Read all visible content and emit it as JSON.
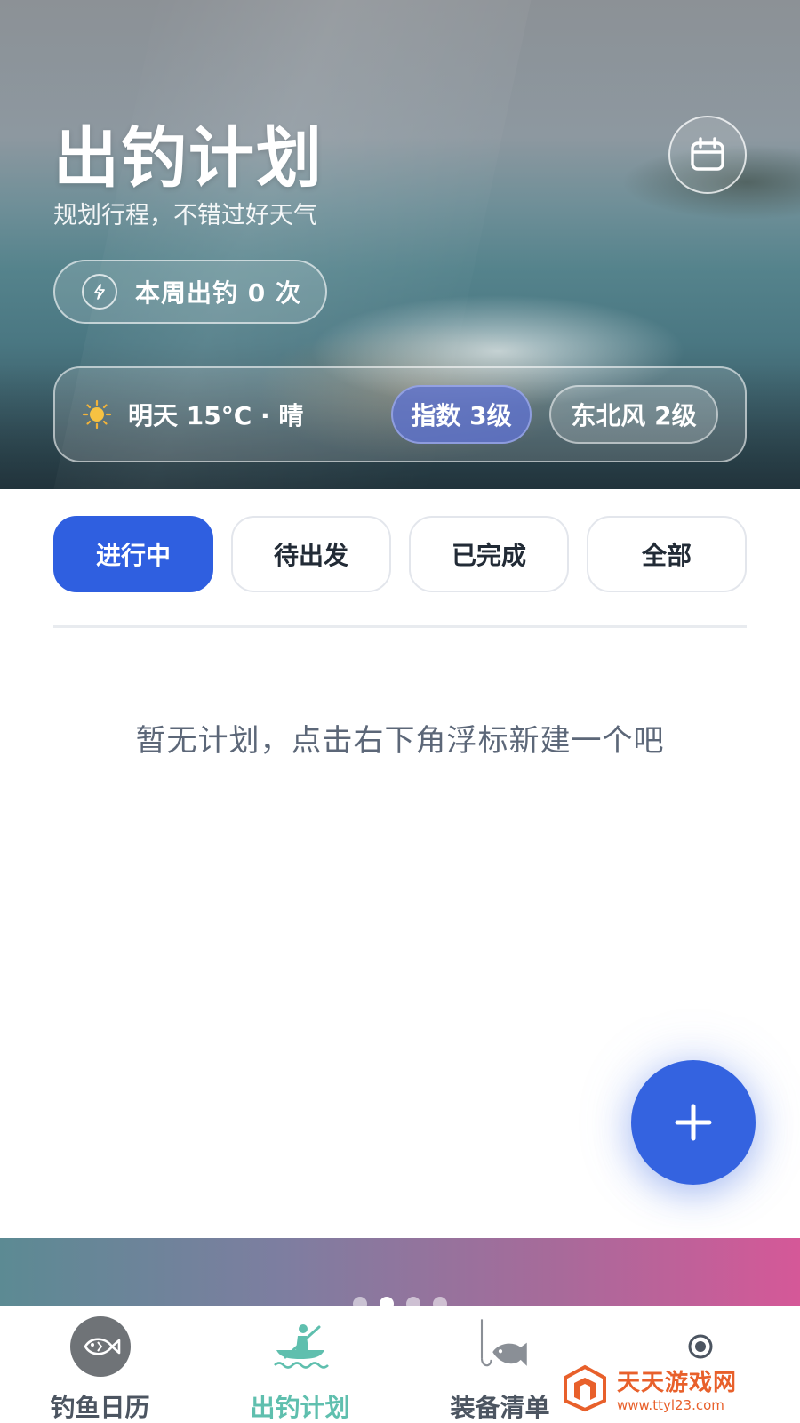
{
  "header": {
    "title": "出钓计划",
    "subtitle": "规划行程，不错过好天气",
    "calendar_icon": "calendar-icon"
  },
  "week_summary": {
    "icon": "lightning-icon",
    "text": "本周出钓 0 次"
  },
  "weather": {
    "icon": "sun-icon",
    "forecast": "明天 15°C · 晴",
    "index_chip": "指数 3级",
    "wind_chip": "东北风 2级"
  },
  "filter_tabs": [
    {
      "label": "进行中",
      "active": true
    },
    {
      "label": "待出发",
      "active": false
    },
    {
      "label": "已完成",
      "active": false
    },
    {
      "label": "全部",
      "active": false
    }
  ],
  "empty_state": {
    "message": "暂无计划，点击右下角浮标新建一个吧"
  },
  "fab": {
    "icon": "plus-icon"
  },
  "carousel": {
    "dot_count": 4,
    "active_index": 1
  },
  "bottom_nav": {
    "items": [
      {
        "label": "钓鱼日历",
        "icon": "fish-icon",
        "active": false
      },
      {
        "label": "出钓计划",
        "icon": "kayak-icon",
        "active": true
      },
      {
        "label": "装备清单",
        "icon": "fishing-hook-icon",
        "active": false
      },
      {
        "label": "",
        "icon": "profile-icon",
        "active": false
      }
    ]
  },
  "watermark": {
    "name": "天天游戏网",
    "url": "www.ttyl23.com"
  },
  "colors": {
    "primary": "#2f5fe0",
    "nav_active": "#5fbfae",
    "watermark": "#e8602b"
  }
}
